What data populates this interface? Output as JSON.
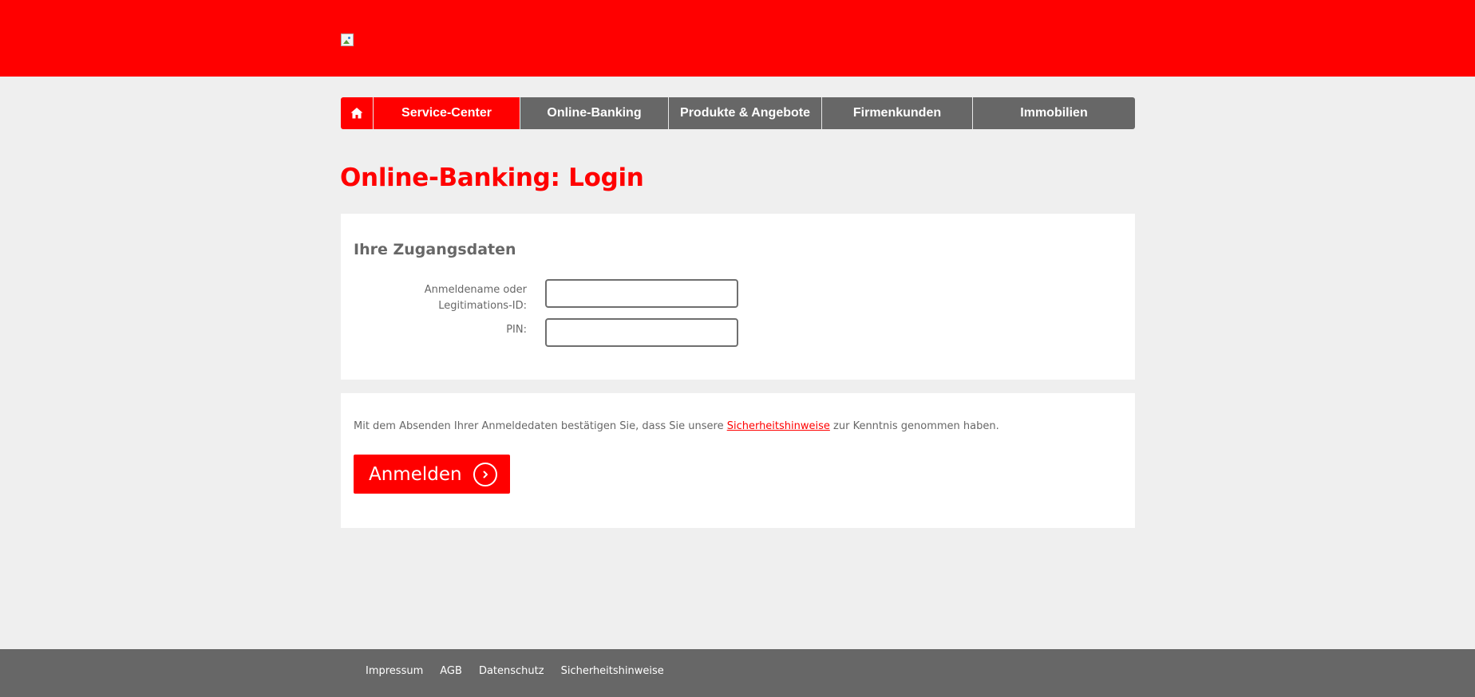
{
  "colors": {
    "brand_red": "#ff0000",
    "nav_gray": "#676767",
    "page_bg": "#efefef",
    "panel_bg": "#ffffff",
    "text_gray": "#676767"
  },
  "header": {
    "logo_icon": "broken-image-icon"
  },
  "nav": {
    "home_icon": "home-icon",
    "items": [
      {
        "label": "Service-Center",
        "active": true
      },
      {
        "label": "Online-Banking",
        "active": false
      },
      {
        "label": "Produkte & Angebote",
        "active": false
      },
      {
        "label": "Firmenkunden",
        "active": false
      },
      {
        "label": "Immobilien",
        "active": false
      }
    ]
  },
  "page": {
    "title": "Online-Banking: Login"
  },
  "login": {
    "section_title": "Ihre Zugangsdaten",
    "username_label": "Anmeldename oder Legitimations-ID:",
    "username_value": "",
    "pin_label": "PIN:",
    "pin_value": ""
  },
  "submit": {
    "notice_before": "Mit dem Absenden Ihrer Anmeldedaten bestätigen Sie, dass Sie unsere ",
    "notice_link": "Sicherheitshinweise",
    "notice_after": " zur Kenntnis genommen haben.",
    "button_label": "Anmelden",
    "button_icon": "chevron-right-icon"
  },
  "footer": {
    "links": [
      "Impressum",
      "AGB",
      "Datenschutz",
      "Sicherheitshinweise"
    ]
  }
}
